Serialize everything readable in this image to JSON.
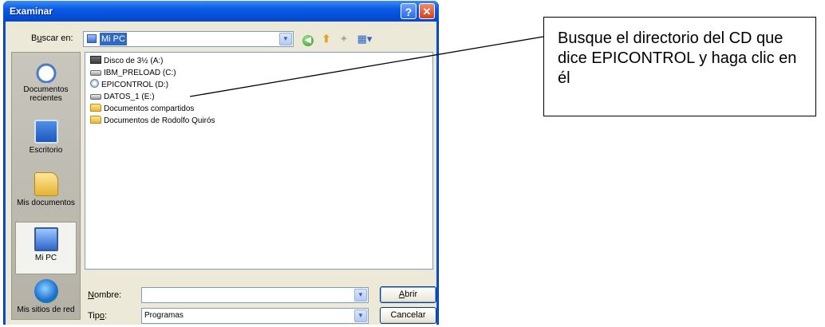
{
  "window": {
    "title": "Examinar",
    "help_glyph": "?",
    "close_glyph": "✕"
  },
  "toolbar": {
    "look_in_label_pre": "B",
    "look_in_label_underlined": "u",
    "look_in_label_post": "scar en:",
    "look_in_value": "Mi PC",
    "back_glyph": "◀",
    "up_glyph": "⬆",
    "new_folder_glyph": "✦",
    "views_glyph": "▦▾"
  },
  "places": [
    {
      "id": "recent",
      "label": "Documentos recientes",
      "icon": "recent-documents-icon"
    },
    {
      "id": "desktop",
      "label": "Escritorio",
      "icon": "desktop-icon"
    },
    {
      "id": "docs",
      "label": "Mis documentos",
      "icon": "my-documents-icon"
    },
    {
      "id": "pc",
      "label": "Mi PC",
      "icon": "my-computer-icon"
    },
    {
      "id": "net",
      "label": "Mis sitios de red",
      "icon": "network-places-icon"
    }
  ],
  "files": [
    {
      "name": "Disco de 3½ (A:)",
      "icon": "floppy-drive-icon"
    },
    {
      "name": "IBM_PRELOAD (C:)",
      "icon": "hard-drive-icon"
    },
    {
      "name": "EPICONTROL (D:)",
      "icon": "cd-drive-icon"
    },
    {
      "name": "DATOS_1 (E:)",
      "icon": "hard-drive-icon"
    },
    {
      "name": "Documentos compartidos",
      "icon": "folder-icon"
    },
    {
      "name": "Documentos de Rodolfo Quirós",
      "icon": "folder-icon"
    }
  ],
  "bottom": {
    "name_label_underlined": "N",
    "name_label_rest": "ombre:",
    "name_value": "",
    "type_label_pre": "Tip",
    "type_label_underlined": "o",
    "type_label_post": ":",
    "type_value": "Programas",
    "open_label_underlined": "A",
    "open_label_rest": "brir",
    "cancel_label": "Cancelar",
    "combo_arrow_glyph": "▼"
  },
  "callout": {
    "text": "Busque el directorio del CD que dice EPICONTROL y haga clic en él"
  },
  "colors": {
    "titlebar": "#0a5ae6",
    "selection": "#316ac5",
    "dialog_bg": "#ece9d8"
  }
}
